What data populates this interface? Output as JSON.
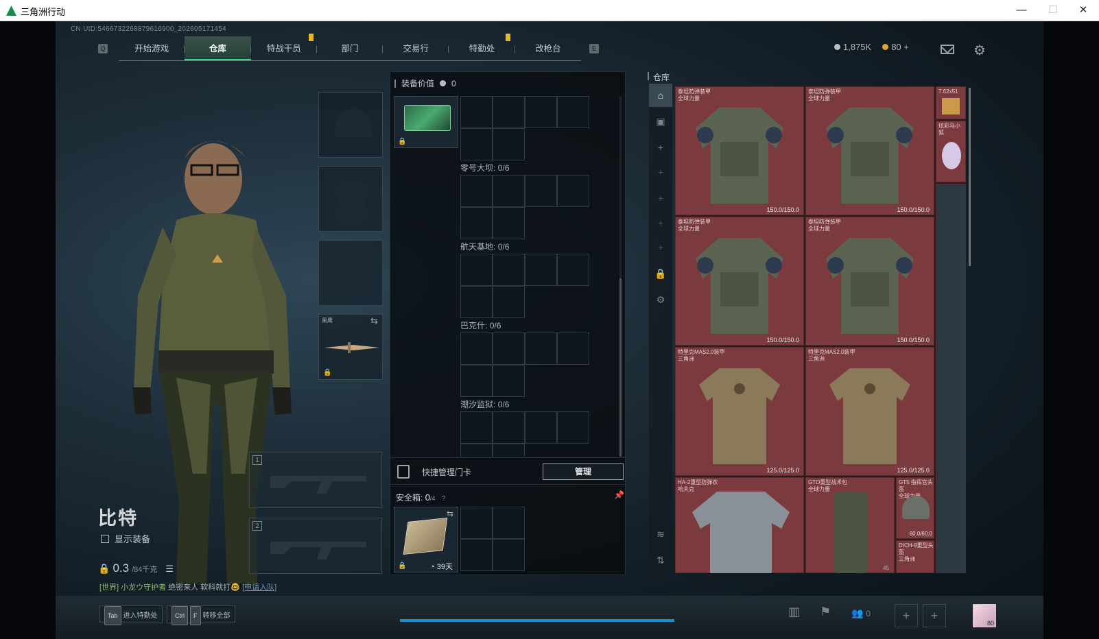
{
  "window": {
    "title": "三角洲行动",
    "min": "—",
    "max": "☐",
    "close": "✕"
  },
  "uid": "CN UID:5466732268879616900_202605171454",
  "nav": {
    "left_key": "Q",
    "right_key": "E",
    "tabs": [
      "开始游戏",
      "仓库",
      "特战干员",
      "部门",
      "交易行",
      "特勤处",
      "改枪台"
    ],
    "active_tab": "仓库"
  },
  "currency": {
    "silver": "1,875K",
    "gold": "80",
    "gold_add": "+"
  },
  "character": {
    "name": "比特",
    "show_equipment": "显示装备",
    "weight_value": "0.3",
    "weight_max": "/84千克"
  },
  "melee_slot": {
    "label": "黑鹰"
  },
  "weapon_slots": [
    "1",
    "2"
  ],
  "chat": {
    "channel": "[世界]",
    "user": "小龙ウ守护者",
    "message": "绝密来人 软科就打🤓",
    "link": "[申请入队]"
  },
  "center": {
    "equip_value_label": "装备价值",
    "equip_value": "0",
    "keyrooms": [
      {
        "name": "零号大坝",
        "count": "0/6"
      },
      {
        "name": "航天基地",
        "count": "0/6"
      },
      {
        "name": "巴克什",
        "count": "0/6"
      },
      {
        "name": "潮汐监狱",
        "count": "0/6"
      }
    ],
    "quick_manage_label": "快捷管理门卡",
    "manage_button": "管理",
    "safebox_label": "安全箱:",
    "safebox_count": "0",
    "safebox_total": "/4",
    "safebox_timer": "39天"
  },
  "warehouse": {
    "title": "仓库",
    "items": [
      {
        "name1": "泰坦防弹装甲",
        "name2": "全球力量",
        "durability": "150.0/150.0"
      },
      {
        "name1": "泰坦防弹装甲",
        "name2": "全球力量",
        "durability": "150.0/150.0"
      },
      {
        "name1": "泰坦防弹装甲",
        "name2": "全球力量",
        "durability": "150.0/150.0"
      },
      {
        "name1": "泰坦防弹装甲",
        "name2": "全球力量",
        "durability": "150.0/150.0"
      },
      {
        "name1": "特里克MAS2.0装甲",
        "name2": "三角洲",
        "durability": "125.0/125.0"
      },
      {
        "name1": "特里克MAS2.0装甲",
        "name2": "三角洲",
        "durability": "125.0/125.0"
      },
      {
        "name1": "HA-2重型防弹衣",
        "name2": "哈夫克",
        "durability": ""
      },
      {
        "name1": "GTO重型战术包",
        "name2": "全球力量",
        "durability": ""
      },
      {
        "name1": "GT5 指挥官头盔",
        "name2": "全球力量",
        "durability": "60.0/60.0"
      },
      {
        "name1": "DICH-9重型头盔",
        "name2": "三角洲",
        "durability": ""
      }
    ],
    "side_items": [
      {
        "name": "7.62x51"
      },
      {
        "name": "炫彩马小狐"
      }
    ],
    "count_badge": "45"
  },
  "bottom": {
    "enter_key": "Tab",
    "enter_label": "进入特勤处",
    "transfer_key1": "Ctrl",
    "transfer_key2": "F",
    "transfer_label": "转移全部",
    "team_count": "0",
    "avatar_level": "80"
  },
  "colors": {
    "accent": "#3ad28a",
    "item_bg": "#7a3a3e",
    "highlight": "#e4b826"
  }
}
